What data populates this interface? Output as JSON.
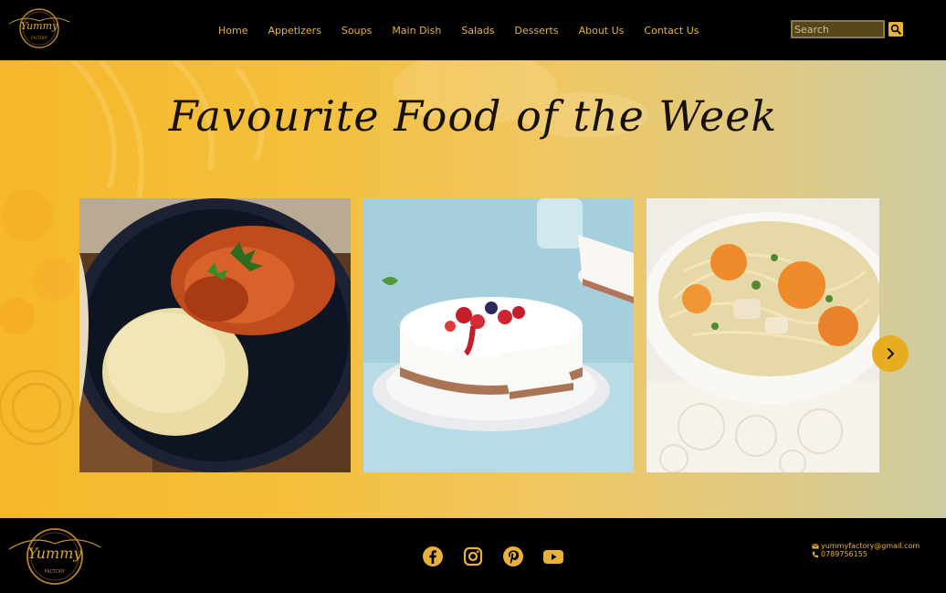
{
  "header": {
    "logo_text": "Yummy",
    "logo_subtext": "FACTORY",
    "nav": [
      {
        "label": "Home"
      },
      {
        "label": "Appetizers"
      },
      {
        "label": "Soups"
      },
      {
        "label": "Main Dish"
      },
      {
        "label": "Salads"
      },
      {
        "label": "Desserts"
      },
      {
        "label": "About Us"
      },
      {
        "label": "Contact Us"
      }
    ],
    "search": {
      "placeholder": "Search",
      "value": ""
    }
  },
  "hero": {
    "title": "Favourite Food of the Week",
    "slides": [
      {
        "image": "curry-with-rice-photo"
      },
      {
        "image": "berry-cheesecake-photo"
      },
      {
        "image": "chicken-noodle-soup-photo"
      }
    ],
    "next_icon": "chevron-right-icon"
  },
  "footer": {
    "logo_text": "Yummy",
    "logo_subtext": "FACTORY",
    "social": [
      "facebook-icon",
      "instagram-icon",
      "pinterest-icon",
      "youtube-icon"
    ],
    "email": "yummyfactory@gmail.com",
    "phone": "0789756155"
  },
  "colors": {
    "accent": "#e8b13a",
    "header_bg": "#000000",
    "hero_gradient_start": "#f6b82a",
    "hero_gradient_end": "#cdcca2"
  }
}
